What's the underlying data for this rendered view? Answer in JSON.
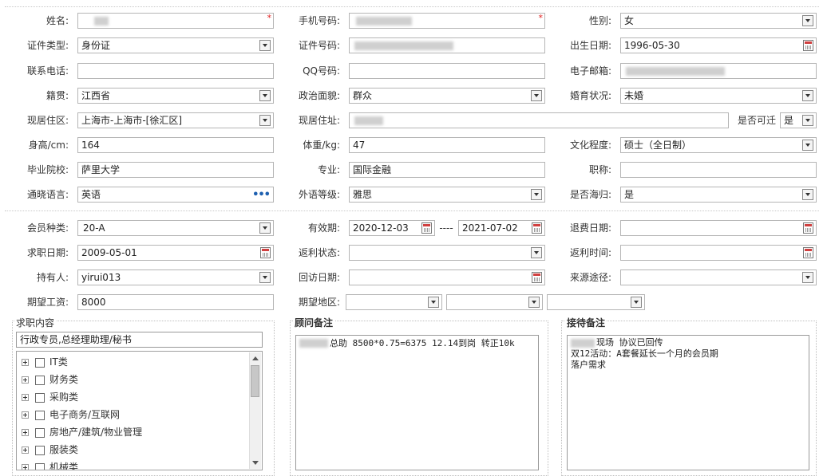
{
  "personal": {
    "name": {
      "label": "姓名:",
      "value": ""
    },
    "mobile": {
      "label": "手机号码:",
      "value": ""
    },
    "gender": {
      "label": "性别:",
      "value": "女"
    },
    "id_type": {
      "label": "证件类型:",
      "value": "身份证"
    },
    "id_number": {
      "label": "证件号码:",
      "value": ""
    },
    "birth_date": {
      "label": "出生日期:",
      "value": "1996-05-30"
    },
    "contact_phone": {
      "label": "联系电话:",
      "value": ""
    },
    "qq": {
      "label": "QQ号码:",
      "value": ""
    },
    "email": {
      "label": "电子邮箱:",
      "value": ""
    },
    "native_place": {
      "label": "籍贯:",
      "value": "江西省"
    },
    "political_status": {
      "label": "政治面貌:",
      "value": "群众"
    },
    "marital_status": {
      "label": "婚育状况:",
      "value": "未婚"
    },
    "residence_area": {
      "label": "现居住区:",
      "value": "上海市-上海市-[徐汇区]"
    },
    "residence_address": {
      "label": "现居住址:",
      "value": ""
    },
    "relocatable": {
      "label": "是否可迁",
      "value": "是"
    },
    "height": {
      "label": "身高/cm:",
      "value": "164"
    },
    "weight": {
      "label": "体重/kg:",
      "value": "47"
    },
    "education": {
      "label": "文化程度:",
      "value": "硕士（全日制）"
    },
    "school": {
      "label": "毕业院校:",
      "value": "萨里大学"
    },
    "major": {
      "label": "专业:",
      "value": "国际金融"
    },
    "title": {
      "label": "职称:",
      "value": ""
    },
    "language": {
      "label": "通晓语言:",
      "value": "英语"
    },
    "language_level": {
      "label": "外语等级:",
      "value": "雅思"
    },
    "overseas_returnee": {
      "label": "是否海归:",
      "value": "是"
    }
  },
  "membership": {
    "member_type": {
      "label": "会员种类:",
      "value": "20-A"
    },
    "validity": {
      "label": "有效期:",
      "start": "2020-12-03",
      "separator": "----",
      "end": "2021-07-02"
    },
    "refund_date": {
      "label": "退费日期:",
      "value": ""
    },
    "job_seek_date": {
      "label": "求职日期:",
      "value": "2009-05-01"
    },
    "rebate_status": {
      "label": "返利状态:",
      "value": ""
    },
    "rebate_time": {
      "label": "返利时间:",
      "value": ""
    },
    "holder": {
      "label": "持有人:",
      "value": "yirui013"
    },
    "revisit_date": {
      "label": "回访日期:",
      "value": ""
    },
    "source": {
      "label": "来源途径:",
      "value": ""
    },
    "expected_salary": {
      "label": "期望工资:",
      "value": "8000"
    },
    "expected_region": {
      "label": "期望地区:",
      "value": ""
    }
  },
  "job_content": {
    "title": "求职内容",
    "selected": "行政专员,总经理助理/秘书",
    "categories": [
      "IT类",
      "财务类",
      "采购类",
      "电子商务/互联网",
      "房地产/建筑/物业管理",
      "服装类",
      "机械类"
    ]
  },
  "consultant_notes": {
    "title": "顾问备注",
    "text": "总助 8500*0.75=6375   12.14到岗  转正10k"
  },
  "reception_notes": {
    "title": "接待备注",
    "lines": [
      "现场 协议已回传",
      "双12活动：A套餐延长一个月的会员期",
      "落户需求"
    ]
  },
  "colors": {
    "required": "#e02020",
    "border": "#b5b5b5",
    "ellipsis": "#1e60b0"
  }
}
